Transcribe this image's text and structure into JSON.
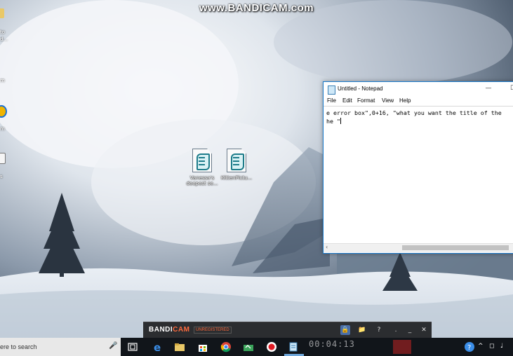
{
  "watermark": "www.BANDICAM.com",
  "desktop": {
    "left_labels": [
      "to",
      "d...",
      "m",
      "m",
      "s"
    ],
    "files": [
      {
        "label_line1": "Vanessa's",
        "label_line2": "deepest se..."
      },
      {
        "label_line1": "KittenPictu...",
        "label_line2": ""
      }
    ]
  },
  "notepad": {
    "title": "Untitled - Notepad",
    "min_glyph": "—",
    "max_glyph": "☐",
    "menu": [
      "File",
      "Edit",
      "Format",
      "View",
      "Help"
    ],
    "line1": "e error box\",0+16, \"what you want the title of the",
    "line2": "he \"",
    "scroll_left": "‹"
  },
  "bandicam": {
    "logo_a": "BANDI",
    "logo_b": "CAM",
    "status": "UNREGISTERED",
    "help": "?",
    "dot": ".",
    "minimize": "_",
    "close": "✕"
  },
  "taskbar": {
    "search_placeholder": "ere to search",
    "timer": "00:04:13"
  },
  "colors": {
    "taskbar": "#11151a",
    "notepad_border": "#1979ca",
    "bandicam_accent": "#ff6a3d"
  }
}
